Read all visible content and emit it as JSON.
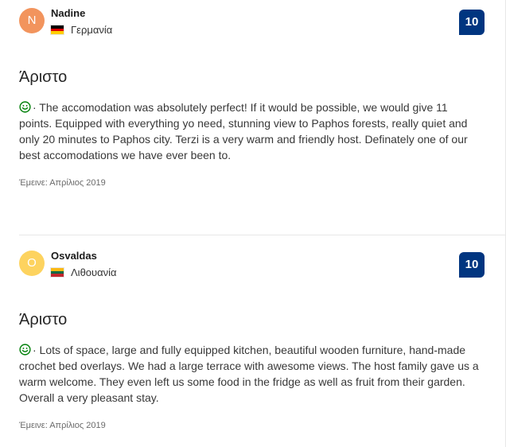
{
  "reviews": [
    {
      "avatar_initial": "N",
      "avatar_color": "#f2945d",
      "name": "Nadine",
      "country": "Γερμανία",
      "flag_colors": [
        "#000000",
        "#dd0000",
        "#ffce00"
      ],
      "score": "10",
      "title": "Άριστο",
      "positive_icon": "smile-icon",
      "text": "· The accomodation was absolutely perfect! If it would be possible, we would give 11 points. Equipped with everything yo need, stunning view to Paphos forests, really quiet and only 20 minutes to Paphos city. Terzi is a very warm and friendly host. Definately one of our best accomodations we have ever been to.",
      "stayed": "Έμεινε: Απρίλιος 2019"
    },
    {
      "avatar_initial": "O",
      "avatar_color": "#fdd35f",
      "name": "Osvaldas",
      "country": "Λιθουανία",
      "flag_colors": [
        "#fdb913",
        "#006a44",
        "#c1272d"
      ],
      "score": "10",
      "title": "Άριστο",
      "positive_icon": "smile-icon",
      "text": "· Lots of space, large and fully equipped kitchen, beautiful wooden furniture, hand-made crochet bed overlays. We had a large terrace with awesome views. The host family gave us a warm welcome. They even left us some food in the fridge as well as fruit from their garden. Overall a very pleasant stay.",
      "stayed": "Έμεινε: Απρίλιος 2019"
    }
  ],
  "colors": {
    "score_badge": "#003580",
    "positive_icon": "#008009"
  }
}
